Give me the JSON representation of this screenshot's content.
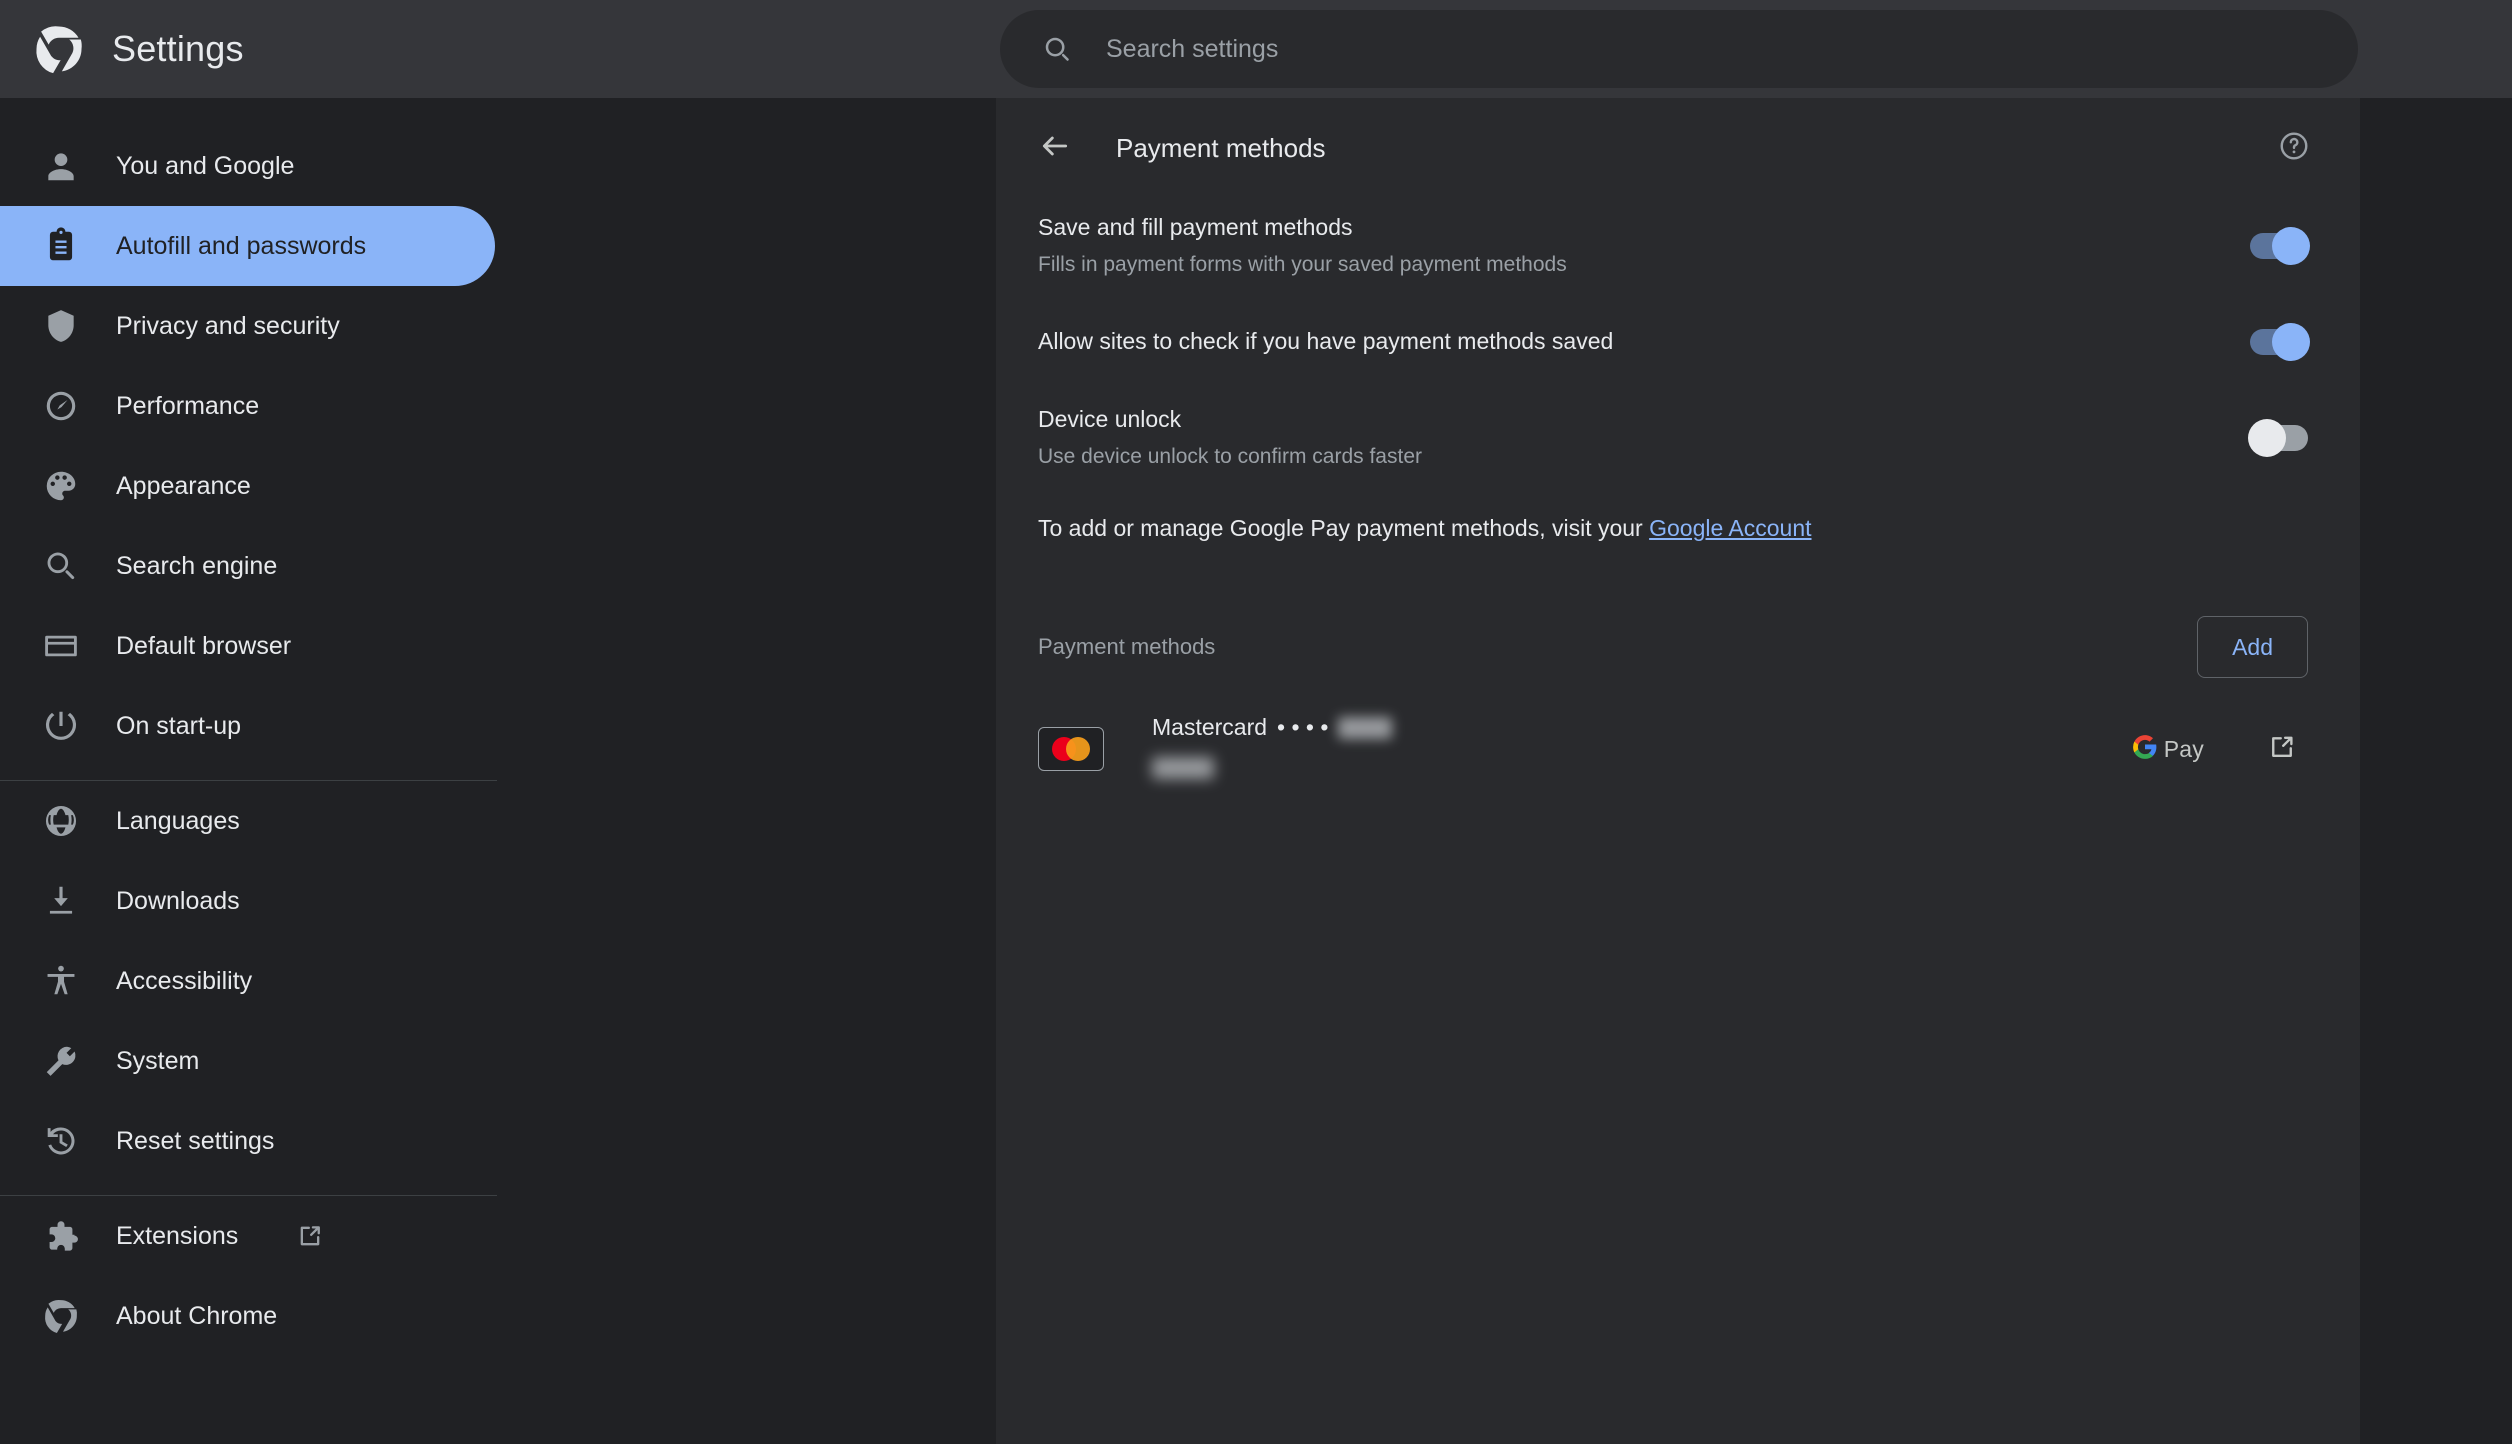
{
  "header": {
    "title": "Settings",
    "logo_icon": "chrome-logo-icon"
  },
  "search": {
    "placeholder": "Search settings",
    "value": "",
    "icon": "search-icon"
  },
  "sidebar": {
    "groups": [
      {
        "items": [
          {
            "label": "You and Google",
            "icon": "person-icon",
            "selected": false
          },
          {
            "label": "Autofill and passwords",
            "icon": "clipboard-icon",
            "selected": true
          },
          {
            "label": "Privacy and security",
            "icon": "shield-icon",
            "selected": false
          },
          {
            "label": "Performance",
            "icon": "speedometer-icon",
            "selected": false
          },
          {
            "label": "Appearance",
            "icon": "palette-icon",
            "selected": false
          },
          {
            "label": "Search engine",
            "icon": "magnifier-icon",
            "selected": false
          },
          {
            "label": "Default browser",
            "icon": "browser-window-icon",
            "selected": false
          },
          {
            "label": "On start-up",
            "icon": "power-icon",
            "selected": false
          }
        ]
      },
      {
        "items": [
          {
            "label": "Languages",
            "icon": "globe-icon",
            "selected": false
          },
          {
            "label": "Downloads",
            "icon": "download-icon",
            "selected": false
          },
          {
            "label": "Accessibility",
            "icon": "accessibility-icon",
            "selected": false
          },
          {
            "label": "System",
            "icon": "wrench-icon",
            "selected": false
          },
          {
            "label": "Reset settings",
            "icon": "history-restore-icon",
            "selected": false
          }
        ]
      },
      {
        "items": [
          {
            "label": "Extensions",
            "icon": "puzzle-icon",
            "external": true,
            "selected": false
          },
          {
            "label": "About Chrome",
            "icon": "chrome-logo-icon",
            "selected": false
          }
        ]
      }
    ]
  },
  "content": {
    "back_icon": "arrow-left-icon",
    "title": "Payment methods",
    "help_icon": "help-circle-icon",
    "preferences": [
      {
        "title": "Save and fill payment methods",
        "subtitle": "Fills in payment forms with your saved payment methods",
        "toggle": "on"
      },
      {
        "title": "Allow sites to check if you have payment methods saved",
        "subtitle": "",
        "toggle": "on"
      },
      {
        "title": "Device unlock",
        "subtitle": "Use device unlock to confirm cards faster",
        "toggle": "off"
      }
    ],
    "gpay_note": {
      "text_before": "To add or manage Google Pay payment methods, visit your ",
      "link_text": "Google Account"
    },
    "section": {
      "label": "Payment methods",
      "add_label": "Add"
    },
    "cards": [
      {
        "network": "Mastercard",
        "dots": "• • • •",
        "number_redacted": true,
        "secondary_redacted": true,
        "gpay_label": "Pay",
        "gpay_icon": "google-g-icon",
        "open_icon": "external-link-icon",
        "thumb_icon": "mastercard-logo-icon"
      }
    ]
  },
  "colors": {
    "accent": "#8ab4f8",
    "background": "#202124",
    "panel": "#292a2d",
    "topbar": "#35363a",
    "text_primary": "#e8eaed",
    "text_secondary": "#9aa0a6",
    "mastercard_red": "#eb001b",
    "mastercard_yellow": "#f79e1b"
  }
}
